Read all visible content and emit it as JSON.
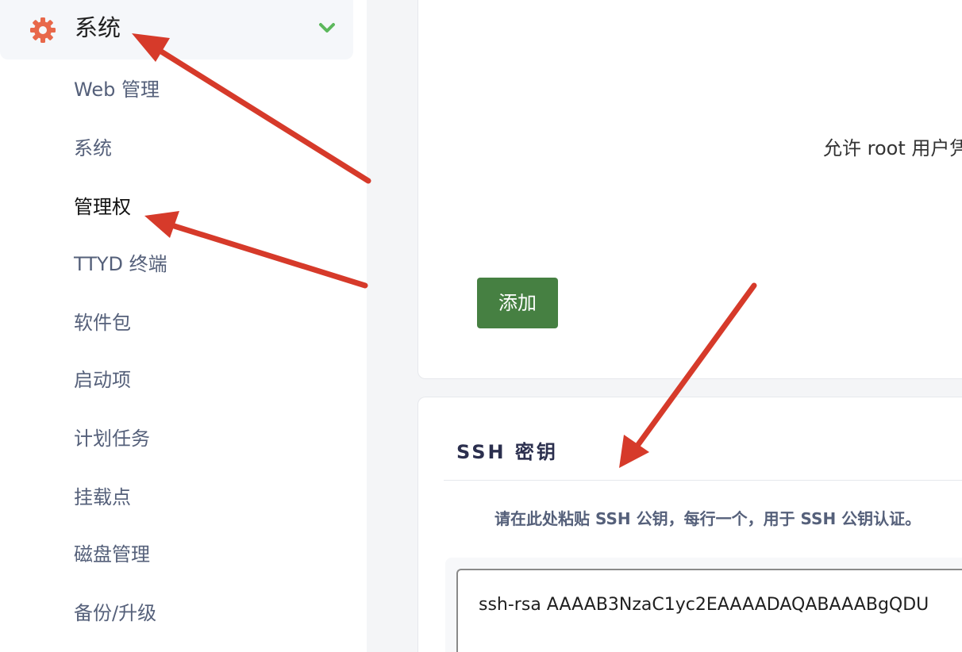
{
  "sidebar": {
    "header": {
      "title": "系统",
      "icon": "gear-icon",
      "expand_icon": "chevron-down-icon",
      "icon_color": "#e8684a",
      "chevron_color": "#5cb85c"
    },
    "items": [
      {
        "label": "Web 管理",
        "active": false
      },
      {
        "label": "系统",
        "active": false
      },
      {
        "label": "管理权",
        "active": true
      },
      {
        "label": "TTYD 终端",
        "active": false
      },
      {
        "label": "软件包",
        "active": false
      },
      {
        "label": "启动项",
        "active": false
      },
      {
        "label": "计划任务",
        "active": false
      },
      {
        "label": "挂载点",
        "active": false
      },
      {
        "label": "磁盘管理",
        "active": false
      },
      {
        "label": "备份/升级",
        "active": false
      }
    ]
  },
  "main": {
    "top_card": {
      "allow_root_label": "允许 root 用户凭",
      "add_button_label": "添加",
      "add_button_color": "#468042"
    },
    "ssh_card": {
      "title": "SSH 密钥",
      "description": "请在此处粘贴 SSH 公钥，每行一个，用于 SSH 公钥认证。",
      "textarea_value": "ssh-rsa AAAAB3NzaC1yc2EAAAADAQABAAABgQDU"
    }
  },
  "annotation": {
    "arrow_color": "#d63a2a"
  }
}
